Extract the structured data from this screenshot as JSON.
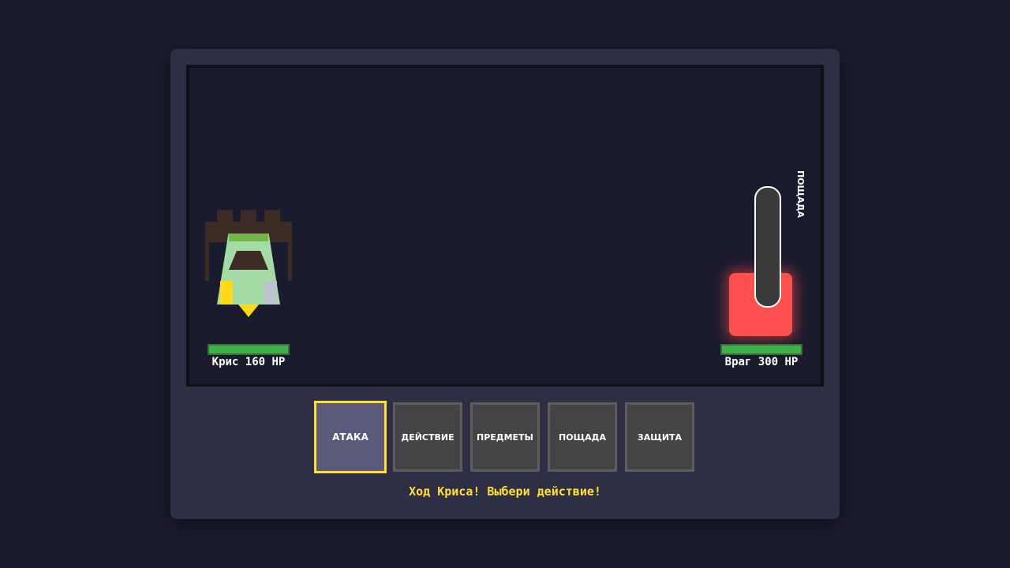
{
  "battle": {
    "hero": {
      "name_hp": "Крис 160 HP",
      "hp_fraction": 1.0
    },
    "enemy": {
      "name_hp": "Враг 300 HP",
      "hp_fraction": 1.0
    },
    "mercy": {
      "label": "ПОЩАДА",
      "fraction": 0.0
    }
  },
  "menu": {
    "attack": "АТАКА",
    "act": "ДЕЙСТВИЕ",
    "items": "ПРЕДМЕТЫ",
    "spare": "ПОЩАДА",
    "defend": "ЗАЩИТА",
    "selected": "attack"
  },
  "status": {
    "message": "Ход Криса! Выбери действие!"
  },
  "colors": {
    "background": "#1b1b2e",
    "panel": "#2e2e44",
    "highlight": "#ffe033",
    "enemy": "#ff5050",
    "hp_bar": "#3fb04a"
  }
}
